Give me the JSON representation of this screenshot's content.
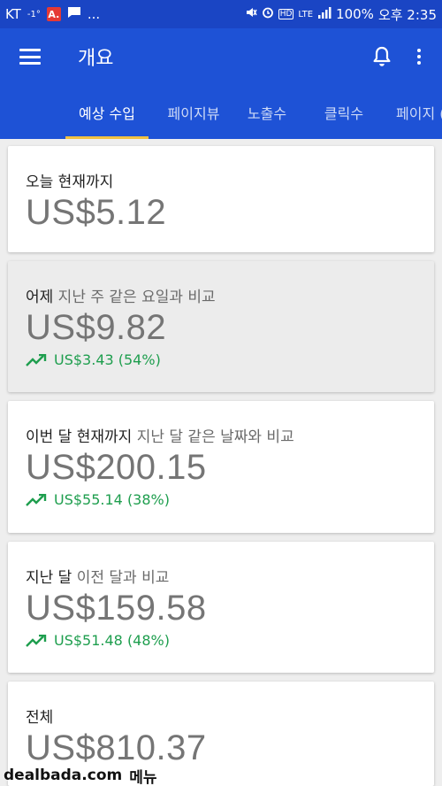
{
  "status_bar": {
    "carrier": "KT",
    "temperature": "-1°",
    "notif_app_badge": "A.",
    "more": "...",
    "hd": "HD",
    "network": "LTE",
    "battery": "100%",
    "time": "오후 2:35"
  },
  "app_bar": {
    "title": "개요"
  },
  "tabs": [
    {
      "label": "예상 수입",
      "active": true
    },
    {
      "label": "페이지뷰",
      "active": false
    },
    {
      "label": "노출수",
      "active": false
    },
    {
      "label": "클릭수",
      "active": false
    },
    {
      "label": "페이지 (",
      "active": false
    }
  ],
  "cards": [
    {
      "label": "오늘 현재까지",
      "sublabel": "",
      "value": "US$5.12",
      "delta": ""
    },
    {
      "label": "어제",
      "sublabel": " 지난 주 같은 요일과 비교",
      "value": "US$9.82",
      "delta": "US$3.43 (54%)"
    },
    {
      "label": "이번 달 현재까지",
      "sublabel": " 지난 달 같은 날짜와 비교",
      "value": "US$200.15",
      "delta": "US$55.14 (38%)"
    },
    {
      "label": "지난 달",
      "sublabel": " 이전 달과 비교",
      "value": "US$159.58",
      "delta": "US$51.48 (48%)"
    },
    {
      "label": "전체",
      "sublabel": "",
      "value": "US$810.37",
      "delta": ""
    }
  ],
  "watermark": {
    "site": "dealbada.com",
    "menu": "메뉴"
  },
  "colors": {
    "app_bar": "#1e52d6",
    "status_bar": "#1a45c4",
    "tab_indicator": "#f0c141",
    "delta_positive": "#1e9e4e"
  }
}
